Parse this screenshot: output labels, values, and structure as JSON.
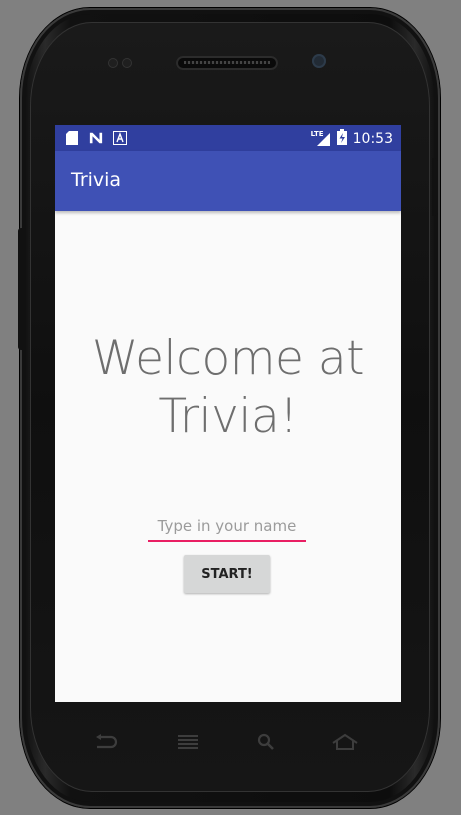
{
  "status_bar": {
    "left_icons": [
      "sd-card-icon",
      "n-icon",
      "a-icon"
    ],
    "network_label": "LTE",
    "time": "10:53"
  },
  "app_bar": {
    "title": "Trivia"
  },
  "main": {
    "welcome_line1": "Welcome at",
    "welcome_line2": "Trivia!",
    "name_placeholder": "Type in your name",
    "name_value": "",
    "start_label": "START!"
  },
  "nav_bar": {
    "buttons": [
      "back-icon",
      "menu-icon",
      "search-icon",
      "home-icon"
    ]
  },
  "colors": {
    "status_bar": "#303f9f",
    "app_bar": "#3f51b5",
    "accent": "#e91e63",
    "background": "#fafafa"
  }
}
